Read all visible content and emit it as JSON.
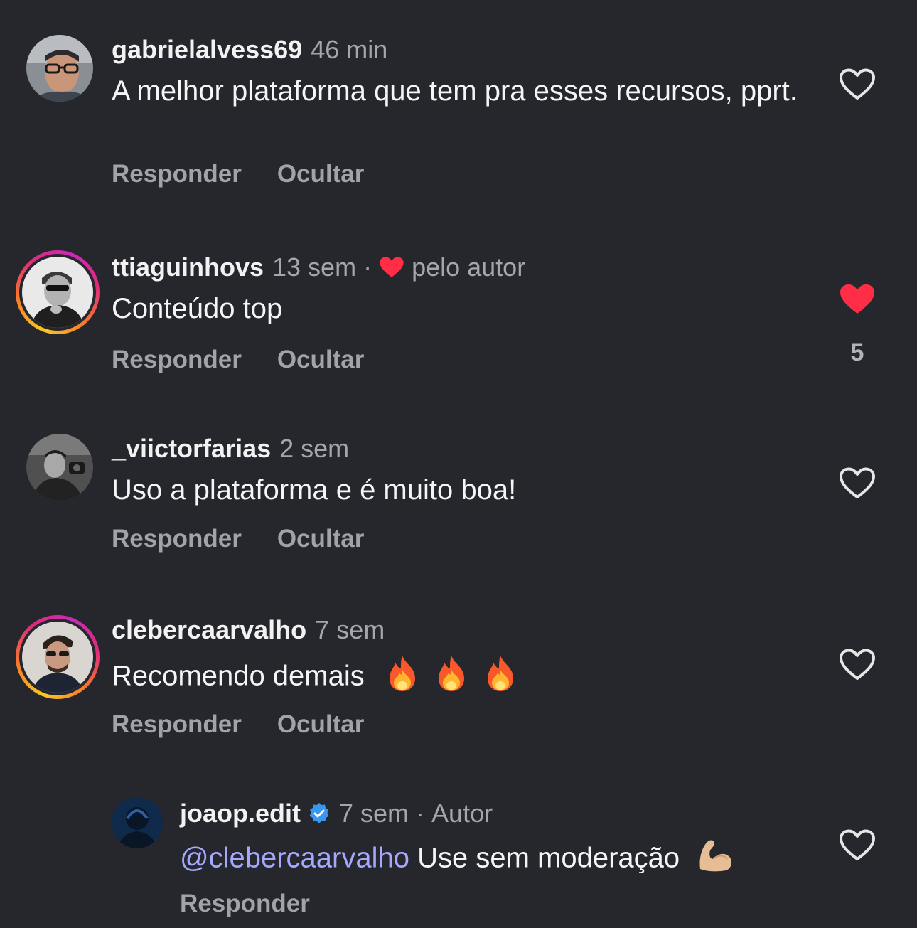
{
  "colors": {
    "background": "#25272c",
    "text_primary": "#f2f2f2",
    "text_secondary": "#a3a6ad",
    "mention": "#a5a8ff",
    "like_active": "#ff2d45",
    "verified": "#3897f0"
  },
  "comments": [
    {
      "username": "gabrielalvess69",
      "time": "46 min",
      "text": "A melhor plataforma que tem pra esses recursos, pprt.",
      "reply_label": "Responder",
      "hide_label": "Ocultar",
      "liked": false,
      "has_story_ring": false
    },
    {
      "username": "ttiaguinhovs",
      "time": "13 sem",
      "separator": "·",
      "liked_by_label": "pelo autor",
      "text": "Conteúdo top",
      "reply_label": "Responder",
      "hide_label": "Ocultar",
      "liked": true,
      "like_count": "5",
      "has_story_ring": true
    },
    {
      "username": "_viictorfarias",
      "time": "2 sem",
      "text": "Uso a plataforma e é muito boa!",
      "reply_label": "Responder",
      "hide_label": "Ocultar",
      "liked": false,
      "has_story_ring": false
    },
    {
      "username": "clebercaarvalho",
      "time": "7 sem",
      "text": "Recomendo demais",
      "emoji": "fire-x3",
      "reply_label": "Responder",
      "hide_label": "Ocultar",
      "liked": false,
      "has_story_ring": true
    }
  ],
  "reply": {
    "username": "joaop.edit",
    "verified": true,
    "time": "7 sem",
    "separator": "·",
    "author_label": "Autor",
    "mention": "@clebercaarvalho",
    "text": "Use sem moderação",
    "emoji": "flexed-biceps",
    "reply_label": "Responder",
    "liked": false
  }
}
